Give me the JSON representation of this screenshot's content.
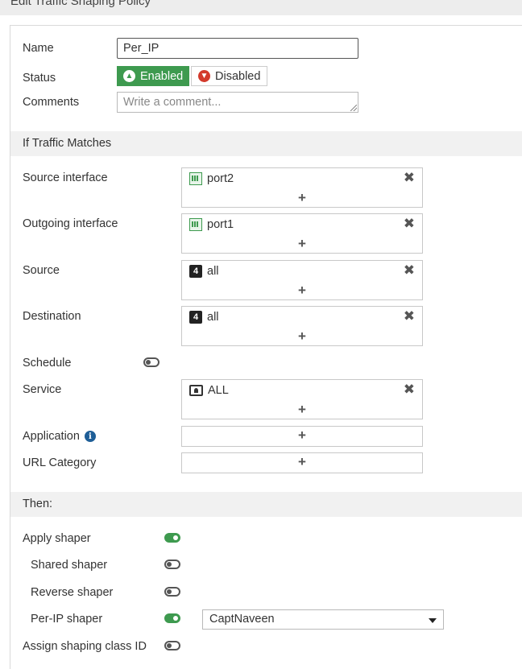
{
  "window": {
    "title": "Edit Traffic Shaping Policy"
  },
  "form": {
    "name_label": "Name",
    "name_value": "Per_IP",
    "status_label": "Status",
    "status_enabled": "Enabled",
    "status_disabled": "Disabled",
    "comments_label": "Comments",
    "comments_placeholder": "Write a comment..."
  },
  "match": {
    "section_title": "If Traffic Matches",
    "source_interface_label": "Source interface",
    "source_interface": "port2",
    "outgoing_interface_label": "Outgoing interface",
    "outgoing_interface": "port1",
    "source_label": "Source",
    "source": "all",
    "destination_label": "Destination",
    "destination": "all",
    "schedule_label": "Schedule",
    "schedule_on": false,
    "service_label": "Service",
    "service": "ALL",
    "application_label": "Application",
    "url_category_label": "URL Category"
  },
  "then": {
    "section_title": "Then:",
    "apply_shaper_label": "Apply shaper",
    "apply_shaper_on": true,
    "shared_shaper_label": "Shared shaper",
    "shared_shaper_on": false,
    "reverse_shaper_label": "Reverse shaper",
    "reverse_shaper_on": false,
    "per_ip_shaper_label": "Per-IP shaper",
    "per_ip_shaper_on": true,
    "per_ip_shaper_value": "CaptNaveen",
    "assign_class_label": "Assign shaping class ID",
    "assign_class_on": false
  },
  "colors": {
    "accent_green": "#3e9a4f",
    "disabled_red": "#d33a2c",
    "info_blue": "#1e5e97"
  }
}
